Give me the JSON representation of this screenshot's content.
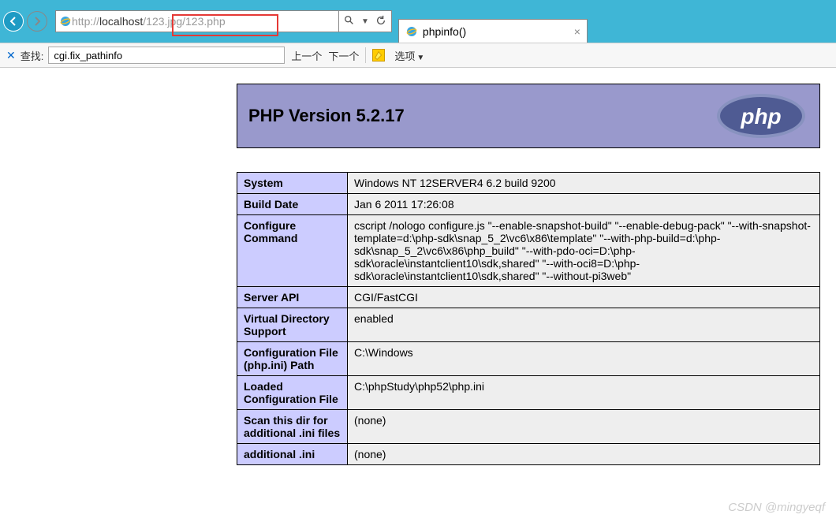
{
  "browser": {
    "url_prefix": "http://",
    "url_host": "localhost",
    "url_path": "/123.jpg/123.php",
    "tab_title": "phpinfo()"
  },
  "findbar": {
    "label": "查找:",
    "value": "cgi.fix_pathinfo",
    "prev": "上一个",
    "next": "下一个",
    "options": "选项"
  },
  "php": {
    "version_title": "PHP Version 5.2.17"
  },
  "rows": [
    {
      "k": "System",
      "v": "Windows NT 12SERVER4 6.2 build 9200"
    },
    {
      "k": "Build Date",
      "v": "Jan 6 2011 17:26:08"
    },
    {
      "k": "Configure Command",
      "v": "cscript /nologo configure.js \"--enable-snapshot-build\" \"--enable-debug-pack\" \"--with-snapshot-template=d:\\php-sdk\\snap_5_2\\vc6\\x86\\template\" \"--with-php-build=d:\\php-sdk\\snap_5_2\\vc6\\x86\\php_build\" \"--with-pdo-oci=D:\\php-sdk\\oracle\\instantclient10\\sdk,shared\" \"--with-oci8=D:\\php-sdk\\oracle\\instantclient10\\sdk,shared\" \"--without-pi3web\""
    },
    {
      "k": "Server API",
      "v": "CGI/FastCGI"
    },
    {
      "k": "Virtual Directory Support",
      "v": "enabled"
    },
    {
      "k": "Configuration File (php.ini) Path",
      "v": "C:\\Windows"
    },
    {
      "k": "Loaded Configuration File",
      "v": "C:\\phpStudy\\php52\\php.ini"
    },
    {
      "k": "Scan this dir for additional .ini files",
      "v": "(none)"
    },
    {
      "k": "additional .ini",
      "v": "(none)"
    }
  ],
  "watermark": "CSDN @mingyeqf"
}
